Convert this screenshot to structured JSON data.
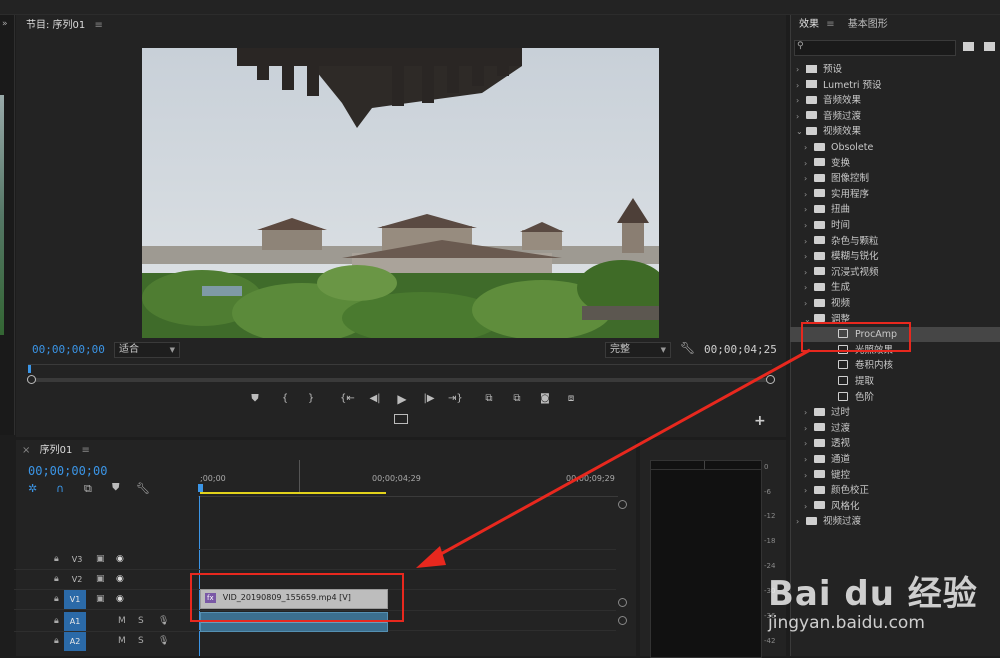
{
  "program_monitor": {
    "title": "节目: 序列01",
    "menu": "≡",
    "timecode_in": "00;00;00;00",
    "fit_label": "适合",
    "quality_label": "完整",
    "duration": "00;00;04;25"
  },
  "transport": [
    "marker",
    "mark-in",
    "mark-out",
    "go-to-in",
    "step-back",
    "play",
    "step-forward",
    "go-to-out",
    "lift",
    "extract",
    "export-frame",
    "comparison-view"
  ],
  "timeline": {
    "close": "×",
    "title": "序列01",
    "menu": "≡",
    "timecode": "00;00;00;00",
    "ruler": [
      ";00;00",
      "00;00;04;29",
      "00;00;09;29"
    ],
    "tracks": [
      {
        "name": "V3",
        "type": "video"
      },
      {
        "name": "V2",
        "type": "video"
      },
      {
        "name": "V1",
        "type": "video"
      },
      {
        "name": "A1",
        "type": "audio",
        "m": "M",
        "s": "S"
      },
      {
        "name": "A2",
        "type": "audio",
        "m": "M",
        "s": "S"
      }
    ],
    "clip": {
      "badge": "fx",
      "label": "VID_20190809_155659.mp4 [V]"
    }
  },
  "effects_panel": {
    "tab_effects": "效果",
    "tab_graphics": "基本图形",
    "menu": "≡",
    "search_placeholder": "",
    "tree": [
      {
        "label": "预设",
        "level": 0,
        "icon": "preset",
        "exp": "closed"
      },
      {
        "label": "Lumetri 预设",
        "level": 0,
        "icon": "preset",
        "exp": "closed"
      },
      {
        "label": "音频效果",
        "level": 0,
        "icon": "folder",
        "exp": "closed"
      },
      {
        "label": "音频过渡",
        "level": 0,
        "icon": "folder",
        "exp": "closed"
      },
      {
        "label": "视频效果",
        "level": 0,
        "icon": "folder",
        "exp": "open"
      },
      {
        "label": "Obsolete",
        "level": 1,
        "icon": "folder",
        "exp": "closed"
      },
      {
        "label": "变换",
        "level": 1,
        "icon": "folder",
        "exp": "closed"
      },
      {
        "label": "图像控制",
        "level": 1,
        "icon": "folder",
        "exp": "closed"
      },
      {
        "label": "实用程序",
        "level": 1,
        "icon": "folder",
        "exp": "closed"
      },
      {
        "label": "扭曲",
        "level": 1,
        "icon": "folder",
        "exp": "closed"
      },
      {
        "label": "时间",
        "level": 1,
        "icon": "folder",
        "exp": "closed"
      },
      {
        "label": "杂色与颗粒",
        "level": 1,
        "icon": "folder",
        "exp": "closed"
      },
      {
        "label": "模糊与锐化",
        "level": 1,
        "icon": "folder",
        "exp": "closed"
      },
      {
        "label": "沉浸式视频",
        "level": 1,
        "icon": "folder",
        "exp": "closed"
      },
      {
        "label": "生成",
        "level": 1,
        "icon": "folder",
        "exp": "closed"
      },
      {
        "label": "视频",
        "level": 1,
        "icon": "folder",
        "exp": "closed"
      },
      {
        "label": "调整",
        "level": 1,
        "icon": "folder",
        "exp": "open"
      },
      {
        "label": "ProcAmp",
        "level": 2,
        "icon": "fx",
        "exp": "none",
        "selected": true
      },
      {
        "label": "光照效果",
        "level": 2,
        "icon": "fx",
        "exp": "none"
      },
      {
        "label": "卷积内核",
        "level": 2,
        "icon": "fx",
        "exp": "none"
      },
      {
        "label": "提取",
        "level": 2,
        "icon": "fx",
        "exp": "none"
      },
      {
        "label": "色阶",
        "level": 2,
        "icon": "fx",
        "exp": "none"
      },
      {
        "label": "过时",
        "level": 1,
        "icon": "folder",
        "exp": "closed"
      },
      {
        "label": "过渡",
        "level": 1,
        "icon": "folder",
        "exp": "closed"
      },
      {
        "label": "透视",
        "level": 1,
        "icon": "folder",
        "exp": "closed"
      },
      {
        "label": "通道",
        "level": 1,
        "icon": "folder",
        "exp": "closed"
      },
      {
        "label": "键控",
        "level": 1,
        "icon": "folder",
        "exp": "closed"
      },
      {
        "label": "颜色校正",
        "level": 1,
        "icon": "folder",
        "exp": "closed"
      },
      {
        "label": "风格化",
        "level": 1,
        "icon": "folder",
        "exp": "closed"
      },
      {
        "label": "视频过渡",
        "level": 0,
        "icon": "folder",
        "exp": "closed"
      }
    ]
  },
  "audio_meter": {
    "ticks": [
      "0",
      "-6",
      "-12",
      "-18",
      "-24",
      "-30",
      "-36",
      "-42"
    ]
  },
  "watermark": {
    "brand": "Bai du 经验",
    "url": "jingyan.baidu.com"
  },
  "colors": {
    "accent": "#3b95e6",
    "annotation": "#e8281e",
    "selected_row": "#464646"
  }
}
